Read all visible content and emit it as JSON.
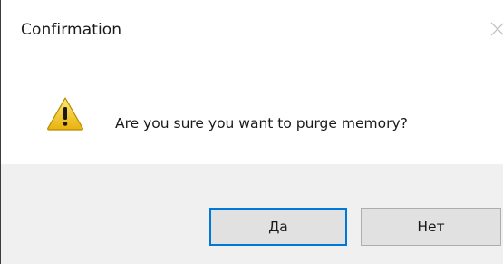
{
  "dialog": {
    "title": "Confirmation",
    "message": "Are you sure you want to purge memory?",
    "icon": "warning-icon",
    "buttons": {
      "yes_label": "Да",
      "no_label": "Нет"
    },
    "colors": {
      "focus_border": "#0078d7",
      "footer_bg": "#f0f0f0",
      "button_bg": "#e1e1e1",
      "warning_fill": "#f2c811"
    }
  }
}
